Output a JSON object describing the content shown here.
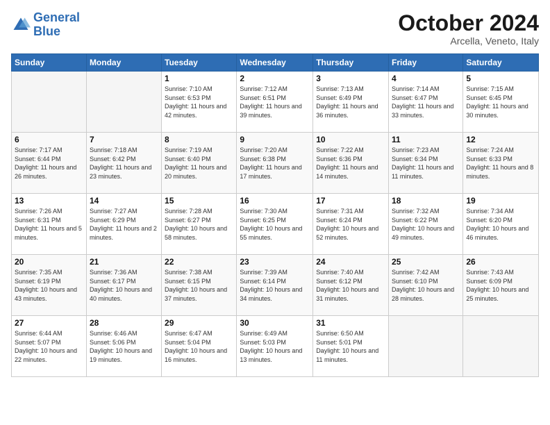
{
  "header": {
    "logo_general": "General",
    "logo_blue": "Blue",
    "month_title": "October 2024",
    "location": "Arcella, Veneto, Italy"
  },
  "weekdays": [
    "Sunday",
    "Monday",
    "Tuesday",
    "Wednesday",
    "Thursday",
    "Friday",
    "Saturday"
  ],
  "weeks": [
    [
      {
        "day": "",
        "sunrise": "",
        "sunset": "",
        "daylight": ""
      },
      {
        "day": "",
        "sunrise": "",
        "sunset": "",
        "daylight": ""
      },
      {
        "day": "1",
        "sunrise": "Sunrise: 7:10 AM",
        "sunset": "Sunset: 6:53 PM",
        "daylight": "Daylight: 11 hours and 42 minutes."
      },
      {
        "day": "2",
        "sunrise": "Sunrise: 7:12 AM",
        "sunset": "Sunset: 6:51 PM",
        "daylight": "Daylight: 11 hours and 39 minutes."
      },
      {
        "day": "3",
        "sunrise": "Sunrise: 7:13 AM",
        "sunset": "Sunset: 6:49 PM",
        "daylight": "Daylight: 11 hours and 36 minutes."
      },
      {
        "day": "4",
        "sunrise": "Sunrise: 7:14 AM",
        "sunset": "Sunset: 6:47 PM",
        "daylight": "Daylight: 11 hours and 33 minutes."
      },
      {
        "day": "5",
        "sunrise": "Sunrise: 7:15 AM",
        "sunset": "Sunset: 6:45 PM",
        "daylight": "Daylight: 11 hours and 30 minutes."
      }
    ],
    [
      {
        "day": "6",
        "sunrise": "Sunrise: 7:17 AM",
        "sunset": "Sunset: 6:44 PM",
        "daylight": "Daylight: 11 hours and 26 minutes."
      },
      {
        "day": "7",
        "sunrise": "Sunrise: 7:18 AM",
        "sunset": "Sunset: 6:42 PM",
        "daylight": "Daylight: 11 hours and 23 minutes."
      },
      {
        "day": "8",
        "sunrise": "Sunrise: 7:19 AM",
        "sunset": "Sunset: 6:40 PM",
        "daylight": "Daylight: 11 hours and 20 minutes."
      },
      {
        "day": "9",
        "sunrise": "Sunrise: 7:20 AM",
        "sunset": "Sunset: 6:38 PM",
        "daylight": "Daylight: 11 hours and 17 minutes."
      },
      {
        "day": "10",
        "sunrise": "Sunrise: 7:22 AM",
        "sunset": "Sunset: 6:36 PM",
        "daylight": "Daylight: 11 hours and 14 minutes."
      },
      {
        "day": "11",
        "sunrise": "Sunrise: 7:23 AM",
        "sunset": "Sunset: 6:34 PM",
        "daylight": "Daylight: 11 hours and 11 minutes."
      },
      {
        "day": "12",
        "sunrise": "Sunrise: 7:24 AM",
        "sunset": "Sunset: 6:33 PM",
        "daylight": "Daylight: 11 hours and 8 minutes."
      }
    ],
    [
      {
        "day": "13",
        "sunrise": "Sunrise: 7:26 AM",
        "sunset": "Sunset: 6:31 PM",
        "daylight": "Daylight: 11 hours and 5 minutes."
      },
      {
        "day": "14",
        "sunrise": "Sunrise: 7:27 AM",
        "sunset": "Sunset: 6:29 PM",
        "daylight": "Daylight: 11 hours and 2 minutes."
      },
      {
        "day": "15",
        "sunrise": "Sunrise: 7:28 AM",
        "sunset": "Sunset: 6:27 PM",
        "daylight": "Daylight: 10 hours and 58 minutes."
      },
      {
        "day": "16",
        "sunrise": "Sunrise: 7:30 AM",
        "sunset": "Sunset: 6:25 PM",
        "daylight": "Daylight: 10 hours and 55 minutes."
      },
      {
        "day": "17",
        "sunrise": "Sunrise: 7:31 AM",
        "sunset": "Sunset: 6:24 PM",
        "daylight": "Daylight: 10 hours and 52 minutes."
      },
      {
        "day": "18",
        "sunrise": "Sunrise: 7:32 AM",
        "sunset": "Sunset: 6:22 PM",
        "daylight": "Daylight: 10 hours and 49 minutes."
      },
      {
        "day": "19",
        "sunrise": "Sunrise: 7:34 AM",
        "sunset": "Sunset: 6:20 PM",
        "daylight": "Daylight: 10 hours and 46 minutes."
      }
    ],
    [
      {
        "day": "20",
        "sunrise": "Sunrise: 7:35 AM",
        "sunset": "Sunset: 6:19 PM",
        "daylight": "Daylight: 10 hours and 43 minutes."
      },
      {
        "day": "21",
        "sunrise": "Sunrise: 7:36 AM",
        "sunset": "Sunset: 6:17 PM",
        "daylight": "Daylight: 10 hours and 40 minutes."
      },
      {
        "day": "22",
        "sunrise": "Sunrise: 7:38 AM",
        "sunset": "Sunset: 6:15 PM",
        "daylight": "Daylight: 10 hours and 37 minutes."
      },
      {
        "day": "23",
        "sunrise": "Sunrise: 7:39 AM",
        "sunset": "Sunset: 6:14 PM",
        "daylight": "Daylight: 10 hours and 34 minutes."
      },
      {
        "day": "24",
        "sunrise": "Sunrise: 7:40 AM",
        "sunset": "Sunset: 6:12 PM",
        "daylight": "Daylight: 10 hours and 31 minutes."
      },
      {
        "day": "25",
        "sunrise": "Sunrise: 7:42 AM",
        "sunset": "Sunset: 6:10 PM",
        "daylight": "Daylight: 10 hours and 28 minutes."
      },
      {
        "day": "26",
        "sunrise": "Sunrise: 7:43 AM",
        "sunset": "Sunset: 6:09 PM",
        "daylight": "Daylight: 10 hours and 25 minutes."
      }
    ],
    [
      {
        "day": "27",
        "sunrise": "Sunrise: 6:44 AM",
        "sunset": "Sunset: 5:07 PM",
        "daylight": "Daylight: 10 hours and 22 minutes."
      },
      {
        "day": "28",
        "sunrise": "Sunrise: 6:46 AM",
        "sunset": "Sunset: 5:06 PM",
        "daylight": "Daylight: 10 hours and 19 minutes."
      },
      {
        "day": "29",
        "sunrise": "Sunrise: 6:47 AM",
        "sunset": "Sunset: 5:04 PM",
        "daylight": "Daylight: 10 hours and 16 minutes."
      },
      {
        "day": "30",
        "sunrise": "Sunrise: 6:49 AM",
        "sunset": "Sunset: 5:03 PM",
        "daylight": "Daylight: 10 hours and 13 minutes."
      },
      {
        "day": "31",
        "sunrise": "Sunrise: 6:50 AM",
        "sunset": "Sunset: 5:01 PM",
        "daylight": "Daylight: 10 hours and 11 minutes."
      },
      {
        "day": "",
        "sunrise": "",
        "sunset": "",
        "daylight": ""
      },
      {
        "day": "",
        "sunrise": "",
        "sunset": "",
        "daylight": ""
      }
    ]
  ]
}
